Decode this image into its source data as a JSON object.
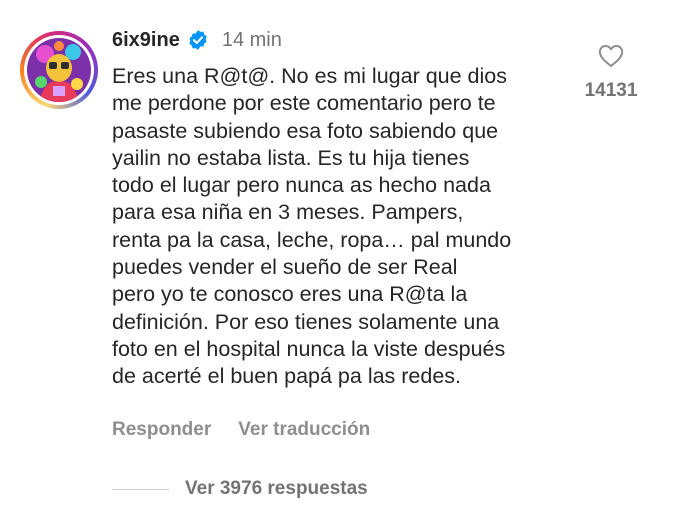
{
  "comment": {
    "avatar": {
      "icon": "profile-photo"
    },
    "username": "6ix9ine",
    "verified_icon": "verified-badge-icon",
    "time": "14 min",
    "text_lines": [
      "Eres una R@t@. No es mi lugar que dios",
      "me perdone por este comentario pero te",
      "pasaste subiendo esa foto sabiendo que",
      "yailin no estaba lista. Es tu hija tienes",
      "todo el lugar pero nunca as hecho nada",
      "para esa niña en 3 meses. Pampers,",
      "renta pa la casa, leche, ropa… pal mundo",
      "puedes vender el sueño de ser Real",
      "pero yo te conosco eres una R@ta la",
      "definición. Por eso tienes solamente una",
      "foto en el hospital nunca la viste después",
      "de acerté el buen papá pa las redes."
    ],
    "like": {
      "icon": "heart-icon",
      "count": "14131"
    },
    "actions": {
      "reply": "Responder",
      "translate": "Ver traducción"
    },
    "replies": {
      "label": "Ver 3976 respuestas"
    }
  },
  "colors": {
    "text": "#262626",
    "secondary": "#737373",
    "action": "#8e8e8e",
    "verified": "#0095f6",
    "background": "#ffffff"
  }
}
